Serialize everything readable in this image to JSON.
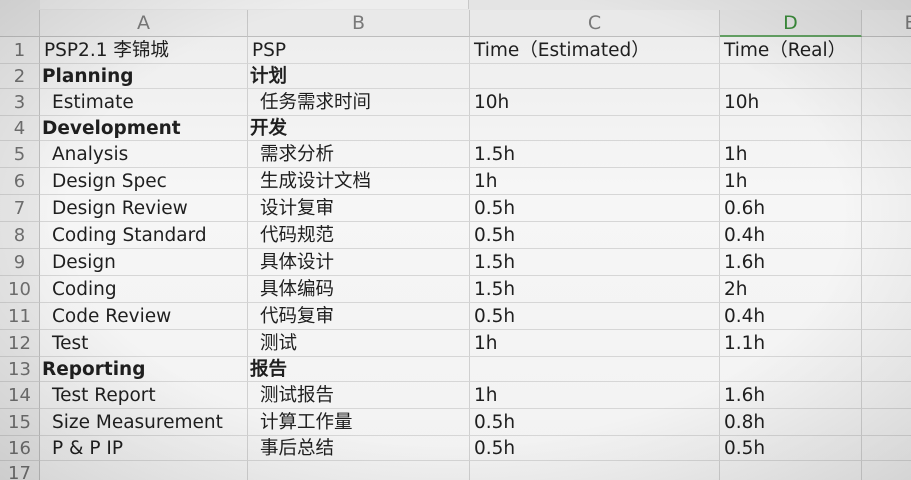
{
  "columns": [
    "A",
    "B",
    "C",
    "D",
    "E"
  ],
  "selected_column": "D",
  "rows": [
    {
      "num": "1",
      "a": "PSP2.1    李锦城",
      "b": "PSP",
      "c": "Time（Estimated）",
      "d": "Time（Real）",
      "style": "header"
    },
    {
      "num": "2",
      "a": "Planning",
      "b": "计划",
      "c": "",
      "d": "",
      "style": "section"
    },
    {
      "num": "3",
      "a": "Estimate",
      "b": "任务需求时间",
      "c": "10h",
      "d": "10h",
      "style": "item"
    },
    {
      "num": "4",
      "a": "Development",
      "b": "开发",
      "c": "",
      "d": "",
      "style": "section"
    },
    {
      "num": "5",
      "a": "Analysis",
      "b": "需求分析",
      "c": "1.5h",
      "d": "1h",
      "style": "item"
    },
    {
      "num": "6",
      "a": "Design Spec",
      "b": "生成设计文档",
      "c": "1h",
      "d": "1h",
      "style": "item"
    },
    {
      "num": "7",
      "a": "Design Review",
      "b": "设计复审",
      "c": "0.5h",
      "d": "0.6h",
      "style": "item"
    },
    {
      "num": "8",
      "a": "Coding Standard",
      "b": "代码规范",
      "c": "0.5h",
      "d": "0.4h",
      "style": "item"
    },
    {
      "num": "9",
      "a": "Design",
      "b": "具体设计",
      "c": "1.5h",
      "d": "1.6h",
      "style": "item"
    },
    {
      "num": "10",
      "a": "Coding",
      "b": "具体编码",
      "c": "1.5h",
      "d": "2h",
      "style": "item"
    },
    {
      "num": "11",
      "a": "Code Review",
      "b": "代码复审",
      "c": "0.5h",
      "d": "0.4h",
      "style": "item"
    },
    {
      "num": "12",
      "a": "Test",
      "b": "测试",
      "c": "1h",
      "d": "1.1h",
      "style": "item"
    },
    {
      "num": "13",
      "a": "Reporting",
      "b": "报告",
      "c": "",
      "d": "",
      "style": "section"
    },
    {
      "num": "14",
      "a": "Test Report",
      "b": "测试报告",
      "c": "1h",
      "d": "1.6h",
      "style": "item"
    },
    {
      "num": "15",
      "a": "Size Measurement",
      "b": "计算工作量",
      "c": "0.5h",
      "d": "0.8h",
      "style": "item"
    },
    {
      "num": "16",
      "a": "P & P IP",
      "b": "事后总结",
      "c": "0.5h",
      "d": "0.5h",
      "style": "item"
    },
    {
      "num": "17",
      "a": "",
      "b": "",
      "c": "",
      "d": "",
      "style": "item"
    }
  ]
}
